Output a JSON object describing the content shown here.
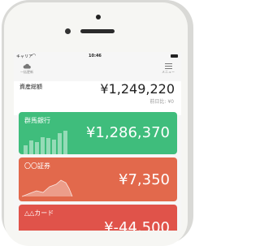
{
  "status_bar": {
    "carrier": "キャリア",
    "time": "10:46"
  },
  "header": {
    "left_label": "一括更新",
    "right_label": "メニュー"
  },
  "balance": {
    "label": "資産総額",
    "amount": "¥1,249,220",
    "diff": "前日比: ¥0"
  },
  "accounts": [
    {
      "name": "群馬銀行",
      "amount": "¥1,286,370",
      "color": "#3fbd7c",
      "chart": "bar",
      "bars": [
        0.35,
        0.55,
        0.5,
        0.7,
        0.65,
        0.6,
        0.85,
        0.95
      ]
    },
    {
      "name": "〇〇証券",
      "amount": "¥7,350",
      "color": "#e2694c",
      "chart": "area"
    },
    {
      "name": "△△カード",
      "amount": "¥-44,500",
      "color": "#e0534a",
      "chart": "none"
    }
  ],
  "colors": {
    "screen_bg": "#f6f6f6",
    "text": "#222222",
    "muted": "#999999"
  },
  "icons": {
    "header_left": "cloud-icon",
    "header_right": "menu-icon"
  }
}
